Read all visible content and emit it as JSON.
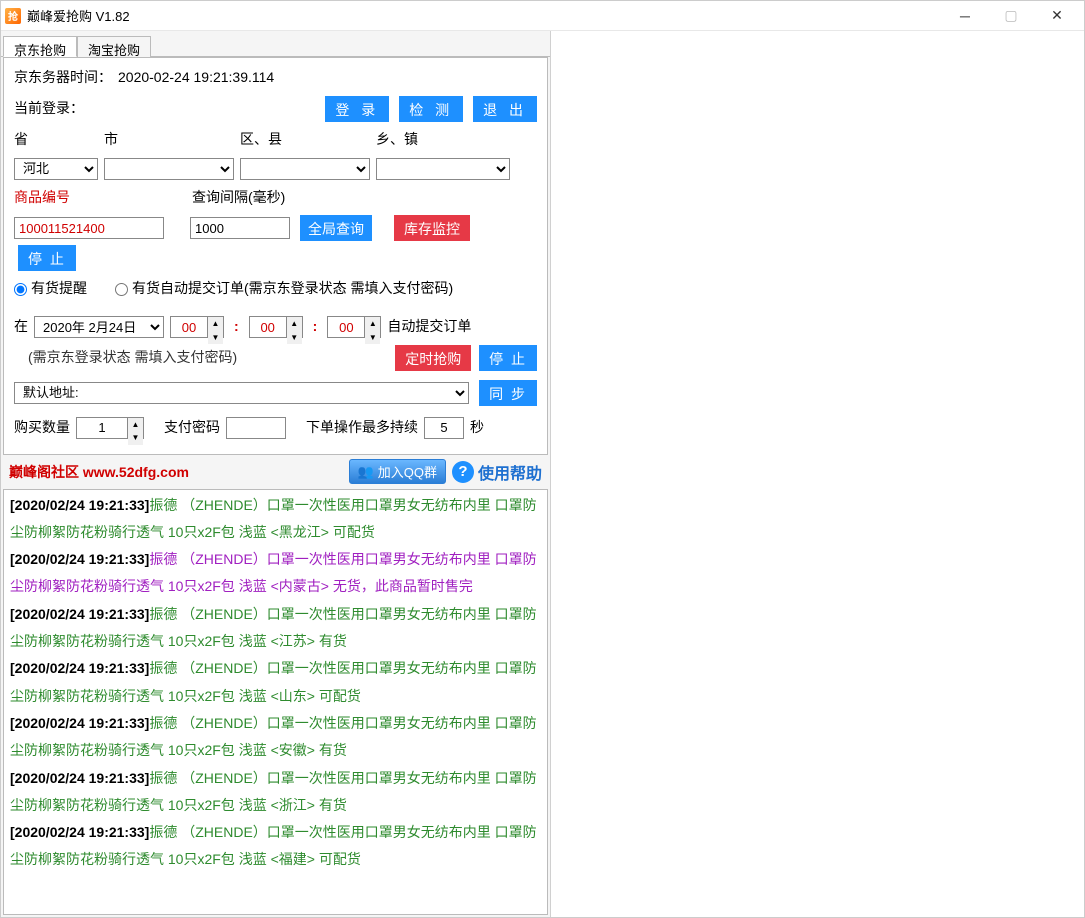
{
  "window": {
    "title": "巅峰爱抢购 V1.82",
    "icon_text": "抢"
  },
  "tabs": {
    "jd": "京东抢购",
    "taobao": "淘宝抢购"
  },
  "server_time_label": "京东务器时间：",
  "server_time_value": "2020-02-24 19:21:39.114",
  "login_label": "当前登录：",
  "buttons": {
    "login": "登 录",
    "detect": "检 测",
    "exit": "退 出",
    "global_query": "全局查询",
    "stock_monitor": "库存监控",
    "stop1": "停 止",
    "timed_buy": "定时抢购",
    "stop2": "停 止",
    "sync": "同 步",
    "join_qq": "加入QQ群",
    "help": "使用帮助"
  },
  "region": {
    "province_label": "省",
    "city_label": "市",
    "district_label": "区、县",
    "town_label": "乡、镇",
    "province_value": "河北"
  },
  "product": {
    "id_label": "商品编号",
    "id_value": "100011521400",
    "interval_label": "查询间隔(毫秒)",
    "interval_value": "1000"
  },
  "radios": {
    "stock_alert": "有货提醒",
    "auto_submit": "有货自动提交订单(需京东登录状态 需填入支付密码)"
  },
  "schedule": {
    "at_label": "在",
    "date_value": "2020年 2月24日",
    "h": "00",
    "m": "00",
    "s": "00",
    "suffix": "自动提交订单",
    "hint": "(需京东登录状态 需填入支付密码)"
  },
  "address": {
    "default_label": "默认地址:"
  },
  "purchase": {
    "qty_label": "购买数量",
    "qty_value": "1",
    "pay_pwd_label": "支付密码",
    "max_duration_label": "下单操作最多持续",
    "max_duration_value": "5",
    "seconds": "秒"
  },
  "footer": {
    "community": "巅峰阁社区 ",
    "url": "www.52dfg.com"
  },
  "log": [
    {
      "color": "green",
      "ts": "[2020/02/24 19:21:33]",
      "text": "振德 （ZHENDE）口罩一次性医用口罩男女无纺布内里 口罩防尘防柳絮防花粉骑行透气 10只x2F包  浅蓝 <黑龙江> 可配货"
    },
    {
      "color": "purple",
      "ts": "[2020/02/24 19:21:33]",
      "text": "振德 （ZHENDE）口罩一次性医用口罩男女无纺布内里 口罩防尘防柳絮防花粉骑行透气 10只x2F包  浅蓝 <内蒙古> 无货，此商品暂时售完"
    },
    {
      "color": "green",
      "ts": "[2020/02/24 19:21:33]",
      "text": "振德 （ZHENDE）口罩一次性医用口罩男女无纺布内里 口罩防尘防柳絮防花粉骑行透气 10只x2F包  浅蓝 <江苏> 有货"
    },
    {
      "color": "green",
      "ts": "[2020/02/24 19:21:33]",
      "text": "振德 （ZHENDE）口罩一次性医用口罩男女无纺布内里 口罩防尘防柳絮防花粉骑行透气 10只x2F包  浅蓝 <山东> 可配货"
    },
    {
      "color": "green",
      "ts": "[2020/02/24 19:21:33]",
      "text": "振德 （ZHENDE）口罩一次性医用口罩男女无纺布内里 口罩防尘防柳絮防花粉骑行透气 10只x2F包  浅蓝 <安徽> 有货"
    },
    {
      "color": "green",
      "ts": "[2020/02/24 19:21:33]",
      "text": "振德 （ZHENDE）口罩一次性医用口罩男女无纺布内里 口罩防尘防柳絮防花粉骑行透气 10只x2F包  浅蓝 <浙江> 有货"
    },
    {
      "color": "green",
      "ts": "[2020/02/24 19:21:33]",
      "text": "振德 （ZHENDE）口罩一次性医用口罩男女无纺布内里 口罩防尘防柳絮防花粉骑行透气 10只x2F包  浅蓝 <福建> 可配货"
    }
  ]
}
